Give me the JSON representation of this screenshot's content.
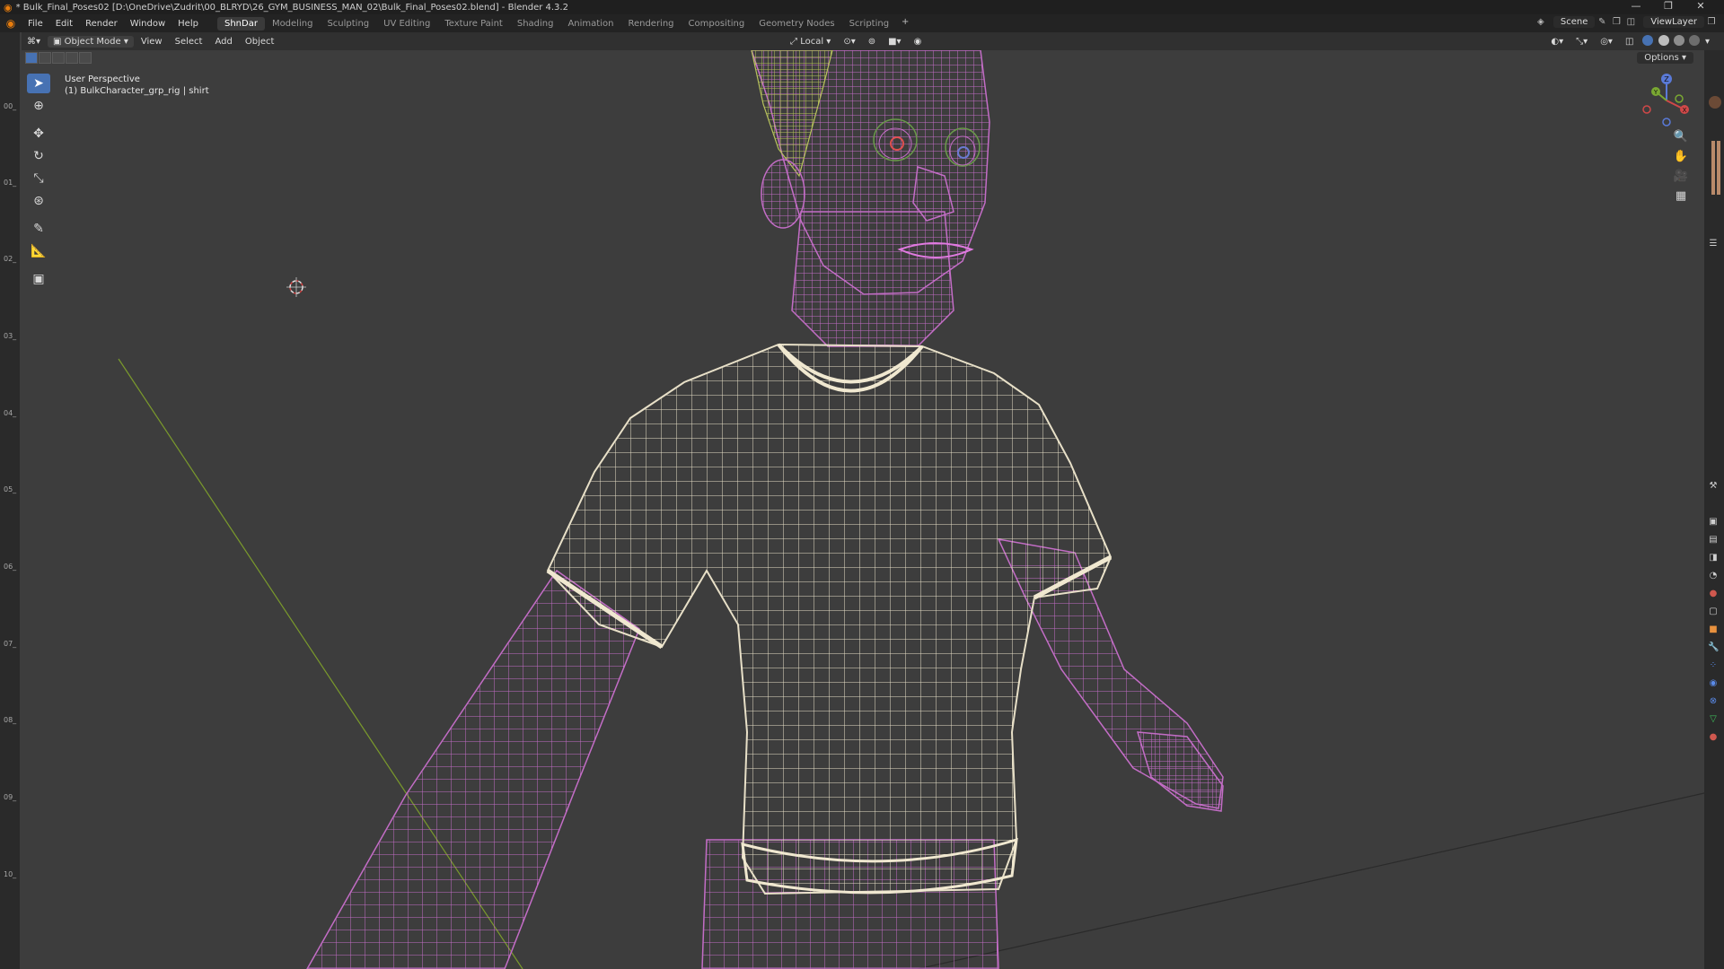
{
  "window": {
    "title": "* Bulk_Final_Poses02 [D:\\OneDrive\\Zudrit\\00_BLRYD\\26_GYM_BUSINESS_MAN_02\\Bulk_Final_Poses02.blend] - Blender 4.3.2",
    "controls": [
      "—",
      "❐",
      "✕"
    ]
  },
  "menubar": {
    "menus": [
      "File",
      "Edit",
      "Render",
      "Window",
      "Help"
    ],
    "workspaces": [
      "ShnDar",
      "Modeling",
      "Sculpting",
      "UV Editing",
      "Texture Paint",
      "Shading",
      "Animation",
      "Rendering",
      "Compositing",
      "Geometry Nodes",
      "Scripting"
    ],
    "active_workspace": "ShnDar",
    "add_tab": "+",
    "scene": "Scene",
    "view_layer": "ViewLayer"
  },
  "viewport_header": {
    "mode": "Object Mode",
    "menus": [
      "View",
      "Select",
      "Add",
      "Object"
    ],
    "transform_orientation": "Local"
  },
  "viewport": {
    "perspective_label": "User Perspective",
    "object_label": "(1) BulkCharacter_grp_rig | shirt",
    "options_label": "Options",
    "gizmo_axis_labels": [
      "Z",
      "Y",
      "X"
    ],
    "colors": {
      "background": "#3d3d3d",
      "body_wire": "#c36dc6",
      "shirt_wire": "#e8e0c8",
      "hair_wire": "#b7c25c",
      "x_axis": "#8a2b2b",
      "y_axis": "#7a9a2c"
    }
  },
  "timeline_marks": [
    "00_",
    "01_",
    "02_",
    "03_",
    "04_",
    "05_",
    "06_",
    "07_",
    "08_",
    "09_",
    "10_"
  ],
  "tools": [
    "select-box-icon",
    "cursor-icon",
    "move-icon",
    "rotate-icon",
    "scale-icon",
    "transform-icon",
    "annotate-icon",
    "measure-icon",
    "add-cube-icon"
  ]
}
